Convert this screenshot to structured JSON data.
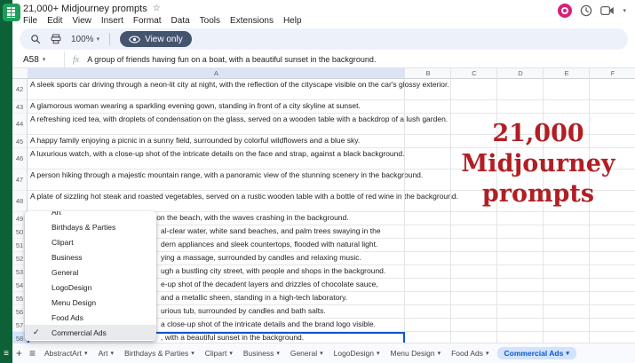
{
  "titlebar": {
    "doc_title": "21,000+ Midjourney prompts",
    "menus": [
      "File",
      "Edit",
      "View",
      "Insert",
      "Format",
      "Data",
      "Tools",
      "Extensions",
      "Help"
    ]
  },
  "toolbar": {
    "zoom": "100%",
    "view_only_label": "View only"
  },
  "formula_bar": {
    "cell_ref": "A58",
    "fx_label": "fx",
    "formula": "A group of friends having fun on a boat, with a beautiful sunset in the background."
  },
  "grid": {
    "columns": [
      "A",
      "B",
      "C",
      "D",
      "E",
      "F"
    ],
    "rows": [
      {
        "n": 42,
        "lines": 2,
        "covered": false,
        "text": "A sleek sports car driving through a neon-lit city at night, with the reflection of the cityscape visible on the car's glossy exterior."
      },
      {
        "n": 43,
        "lines": 1,
        "covered": false,
        "text": "A glamorous woman wearing a sparkling evening gown, standing in front of a city skyline at sunset."
      },
      {
        "n": 44,
        "lines": 2,
        "covered": false,
        "text": "A refreshing iced tea, with droplets of condensation on the glass, served on a wooden table with a backdrop of a lush garden."
      },
      {
        "n": 45,
        "lines": 1,
        "covered": false,
        "text": "A happy family enjoying a picnic in a sunny field, surrounded by colorful wildflowers and a blue sky."
      },
      {
        "n": 46,
        "lines": 2,
        "covered": false,
        "text": "A luxurious watch, with a close-up shot of the intricate details on the face and strap, against a black background."
      },
      {
        "n": 47,
        "lines": 2,
        "covered": false,
        "text": "A person hiking through a majestic mountain range, with a panoramic view of the stunning scenery in the background."
      },
      {
        "n": 48,
        "lines": 2,
        "covered": false,
        "text": "A plate of sizzling hot steak and roasted vegetables, served on a rustic wooden table with a bottle of red wine in the background."
      },
      {
        "n": 49,
        "lines": 1,
        "covered": false,
        "text": "A fitness model performing a workout on the beach, with the waves crashing in the background."
      },
      {
        "n": 50,
        "lines": 1,
        "covered": true,
        "text": "al-clear water, white sand beaches, and palm trees swaying in the"
      },
      {
        "n": 51,
        "lines": 1,
        "covered": true,
        "text": "dern appliances and sleek countertops, flooded with natural light."
      },
      {
        "n": 52,
        "lines": 1,
        "covered": true,
        "text": "ying a massage, surrounded by candles and relaxing music."
      },
      {
        "n": 53,
        "lines": 1,
        "covered": true,
        "text": "ugh a bustling city street, with people and shops in the background."
      },
      {
        "n": 54,
        "lines": 1,
        "covered": true,
        "text": "e-up shot of the decadent layers and drizzles of chocolate sauce,"
      },
      {
        "n": 55,
        "lines": 1,
        "covered": true,
        "text": "and a metallic sheen, standing in a high-tech laboratory."
      },
      {
        "n": 56,
        "lines": 1,
        "covered": true,
        "text": "urious tub, surrounded by candles and bath salts."
      },
      {
        "n": 57,
        "lines": 1,
        "covered": true,
        "text": "a close-up shot of the intricate details and the brand logo visible."
      },
      {
        "n": 58,
        "lines": 1,
        "covered": true,
        "selected": true,
        "text": ", with a beautiful sunset in the background."
      }
    ]
  },
  "sheet_menu": {
    "partial_top_item": "Art",
    "items": [
      "Birthdays & Parties",
      "Clipart",
      "Business",
      "General",
      "LogoDesign",
      "Menu Design",
      "Food Ads",
      "Commercial Ads"
    ],
    "selected": "Commercial Ads"
  },
  "overlay": {
    "lines": [
      "21,000",
      "Midjourney",
      "prompts"
    ],
    "color": "#b01f24"
  },
  "tabs": {
    "items": [
      "AbstractArt",
      "Art",
      "Birthdays & Parties",
      "Clipart",
      "Business",
      "General",
      "LogoDesign",
      "Menu Design",
      "Food Ads",
      "Commercial Ads"
    ],
    "active": "Commercial Ads"
  },
  "icons": {
    "star": "☆",
    "caret_down": "▾",
    "check": "✓",
    "plus": "+",
    "all_sheets": "≡"
  }
}
